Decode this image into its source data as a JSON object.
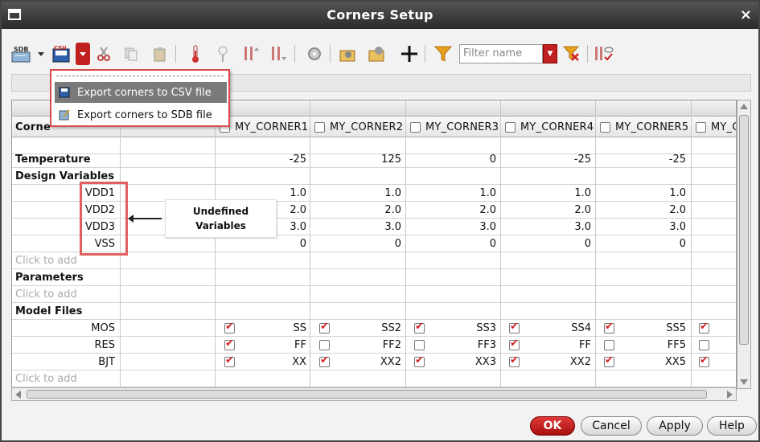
{
  "window": {
    "title": "Corners Setup",
    "close_glyph": "×"
  },
  "toolbar": {
    "filter_placeholder": "Filter name",
    "icons": [
      "sdb-icon",
      "csv-icon",
      "cut-icon",
      "copy-icon",
      "paste-icon",
      "thermometer-icon",
      "pin-icon",
      "variables-icon",
      "parameters-icon",
      "settings-icon",
      "load-icon",
      "save-icon",
      "add-icon",
      "filter-icon",
      "filter-dropdown-icon",
      "clear-filter-icon",
      "show-hide-icon"
    ]
  },
  "export_menu": {
    "items": [
      {
        "label": "Export corners to CSV file"
      },
      {
        "label": "Export corners to SDB file"
      }
    ]
  },
  "table": {
    "first_header": "Corne",
    "corners": [
      {
        "name": "MY_CORNER1"
      },
      {
        "name": "MY_CORNER2"
      },
      {
        "name": "MY_CORNER3"
      },
      {
        "name": "MY_CORNER4"
      },
      {
        "name": "MY_CORNER5"
      },
      {
        "name": "MY_C"
      }
    ],
    "temperature_label": "Temperature",
    "temperature": [
      "-25",
      "125",
      "0",
      "-25",
      "-25",
      ""
    ],
    "design_vars_label": "Design Variables",
    "design_vars": [
      {
        "name": "VDD1",
        "values": [
          "1.0",
          "1.0",
          "1.0",
          "1.0",
          "1.0",
          ""
        ]
      },
      {
        "name": "VDD2",
        "values": [
          "2.0",
          "2.0",
          "2.0",
          "2.0",
          "2.0",
          ""
        ]
      },
      {
        "name": "VDD3",
        "values": [
          "3.0",
          "3.0",
          "3.0",
          "3.0",
          "3.0",
          ""
        ]
      },
      {
        "name": "VSS",
        "values": [
          "0",
          "0",
          "0",
          "0",
          "0",
          ""
        ]
      }
    ],
    "click_to_add": "Click to add",
    "parameters_label": "Parameters",
    "model_files_label": "Model Files",
    "model_files": [
      {
        "name": "MOS",
        "cells": [
          {
            "checked": true,
            "value": "SS"
          },
          {
            "checked": true,
            "value": "SS2"
          },
          {
            "checked": true,
            "value": "SS3"
          },
          {
            "checked": true,
            "value": "SS4"
          },
          {
            "checked": true,
            "value": "SS5"
          },
          {
            "checked": true,
            "value": ""
          }
        ]
      },
      {
        "name": "RES",
        "cells": [
          {
            "checked": true,
            "value": "FF"
          },
          {
            "checked": false,
            "value": "FF2"
          },
          {
            "checked": false,
            "value": "FF3"
          },
          {
            "checked": true,
            "value": "FF"
          },
          {
            "checked": false,
            "value": "FF5"
          },
          {
            "checked": false,
            "value": ""
          }
        ]
      },
      {
        "name": "BJT",
        "cells": [
          {
            "checked": true,
            "value": "XX"
          },
          {
            "checked": true,
            "value": "XX2"
          },
          {
            "checked": true,
            "value": "XX3"
          },
          {
            "checked": true,
            "value": "XX2"
          },
          {
            "checked": true,
            "value": "XX5"
          },
          {
            "checked": true,
            "value": ""
          }
        ]
      }
    ]
  },
  "annotation": {
    "line1": "Undefined",
    "line2": "Variables"
  },
  "buttons": {
    "ok": "OK",
    "cancel": "Cancel",
    "apply": "Apply",
    "help": "Help"
  },
  "colors": {
    "accent": "#c02020",
    "highlight_box": "#e06060"
  }
}
